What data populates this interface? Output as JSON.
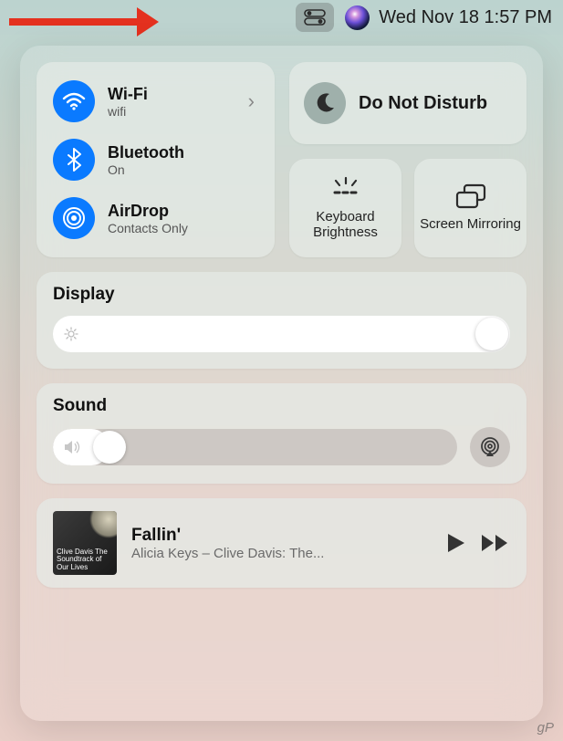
{
  "menubar": {
    "datetime": "Wed Nov 18  1:57 PM"
  },
  "connectivity": {
    "wifi": {
      "title": "Wi-Fi",
      "subtitle": "wifi"
    },
    "bluetooth": {
      "title": "Bluetooth",
      "subtitle": "On"
    },
    "airdrop": {
      "title": "AirDrop",
      "subtitle": "Contacts Only"
    }
  },
  "dnd": {
    "title": "Do Not Disturb"
  },
  "keyboard_brightness": {
    "label": "Keyboard Brightness"
  },
  "screen_mirroring": {
    "label": "Screen Mirroring"
  },
  "display": {
    "title": "Display",
    "value_pct": 100
  },
  "sound": {
    "title": "Sound",
    "value_pct": 14
  },
  "now_playing": {
    "title": "Fallin'",
    "artist": "Alicia Keys – Clive Davis: The...",
    "album_art_text": "Clive Davis\nThe Soundtrack of Our Lives"
  },
  "watermark": "gP",
  "colors": {
    "accent_blue": "#0a7aff"
  }
}
